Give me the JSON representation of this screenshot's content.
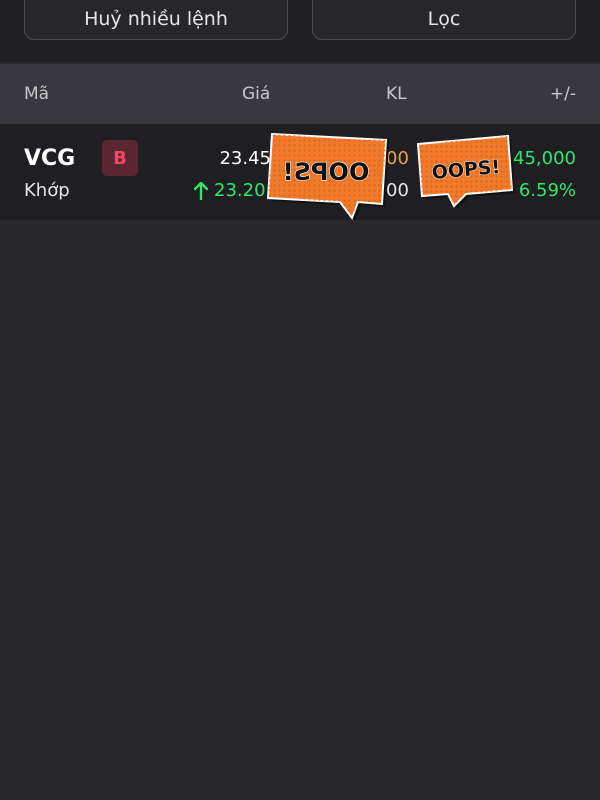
{
  "toolbar": {
    "cancel_multiple_label": "Huỷ nhiều lệnh",
    "filter_label": "Lọc"
  },
  "table": {
    "headers": {
      "code": "Mã",
      "price": "Giá",
      "volume": "KL",
      "change": "+/-"
    },
    "rows": [
      {
        "symbol": "VCG",
        "side": "B",
        "status": "Khớp",
        "order_price": "23.45",
        "matched_price": "23.20",
        "order_volume": "00",
        "matched_volume": "00",
        "change_value": "145,000",
        "change_percent": "6.59%"
      }
    ]
  },
  "stickers": {
    "left_text": "OOPS!",
    "right_text": "OOPS!"
  },
  "colors": {
    "background": "#28282d",
    "header": "#38383e",
    "row": "#1f1f23",
    "up_green": "#2ee76b",
    "buy_red": "#f04a62",
    "volume_orange": "#e8a04a",
    "sticker_orange": "#f07a2a"
  },
  "icons": {
    "matched_price_direction": "arrow-up-icon"
  }
}
